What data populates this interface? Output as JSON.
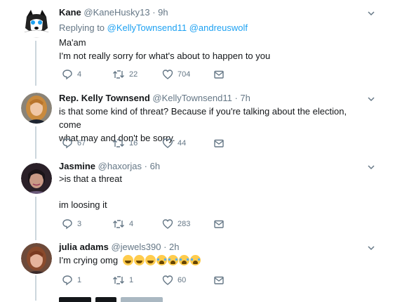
{
  "tweets": [
    {
      "name": "Kane",
      "handle": "@KaneHusky13",
      "time": "9h",
      "replying_label": "Replying to",
      "replying_to": [
        "@KellyTownsend11",
        "@andreuswolf"
      ],
      "lines": [
        "Ma'am",
        "I'm not really sorry for what's about to happen to you"
      ],
      "replies": "4",
      "retweets": "22",
      "likes": "704"
    },
    {
      "name": "Rep. Kelly Townsend",
      "handle": "@KellyTownsend11",
      "time": "7h",
      "lines": [
        "is that some kind of threat? Because if you're talking about the election, come",
        "what may and don't be sorry."
      ],
      "replies": "67",
      "retweets": "16",
      "likes": "44"
    },
    {
      "name": "Jasmine",
      "handle": "@haxorjas",
      "time": "6h",
      "lines": [
        ">is that a threat",
        "",
        "im loosing it"
      ],
      "replies": "3",
      "retweets": "4",
      "likes": "283"
    },
    {
      "name": "julia adams",
      "handle": "@jewels390",
      "time": "2h",
      "lines": [
        "I'm crying omg"
      ],
      "emojis": [
        "face-with-tears-of-joy",
        "face-with-tears-of-joy",
        "face-with-tears-of-joy",
        "loudly-crying-face",
        "loudly-crying-face",
        "loudly-crying-face",
        "loudly-crying-face"
      ],
      "replies": "1",
      "retweets": "1",
      "likes": "60"
    }
  ],
  "separator": "·",
  "colors": {
    "text": "#14171a",
    "secondary": "#657786",
    "link": "#1da1f2",
    "connector": "#ccd6dd"
  },
  "icons": [
    "reply-icon",
    "retweet-icon",
    "like-icon",
    "direct-message-icon",
    "chevron-down-icon"
  ]
}
